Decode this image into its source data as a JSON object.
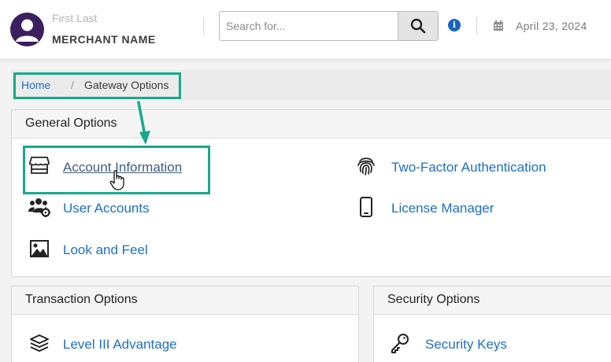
{
  "header": {
    "user_first_last": "First Last",
    "merchant_name": "MERCHANT NAME",
    "search": {
      "placeholder": "Search for..."
    },
    "date": "April 23, 2024"
  },
  "breadcrumb": {
    "home": "Home",
    "separator": "/",
    "current": "Gateway Options"
  },
  "sections": {
    "general": {
      "title": "General Options",
      "items": [
        {
          "label": "Account Information",
          "icon": "storefront-icon"
        },
        {
          "label": "User Accounts",
          "icon": "users-gear-icon"
        },
        {
          "label": "Look and Feel",
          "icon": "image-icon"
        },
        {
          "label": "Two-Factor Authentication",
          "icon": "fingerprint-icon"
        },
        {
          "label": "License Manager",
          "icon": "mobile-phone-icon"
        }
      ]
    },
    "transaction": {
      "title": "Transaction Options",
      "items": [
        {
          "label": "Level III Advantage",
          "icon": "layers-icon"
        }
      ]
    },
    "security": {
      "title": "Security Options",
      "items": [
        {
          "label": "Security Keys",
          "icon": "key-icon"
        }
      ]
    }
  },
  "colors": {
    "link": "#1c6fc9",
    "highlight": "#17a98b",
    "avatar": "#3b1f5e",
    "info": "#1565c0"
  }
}
